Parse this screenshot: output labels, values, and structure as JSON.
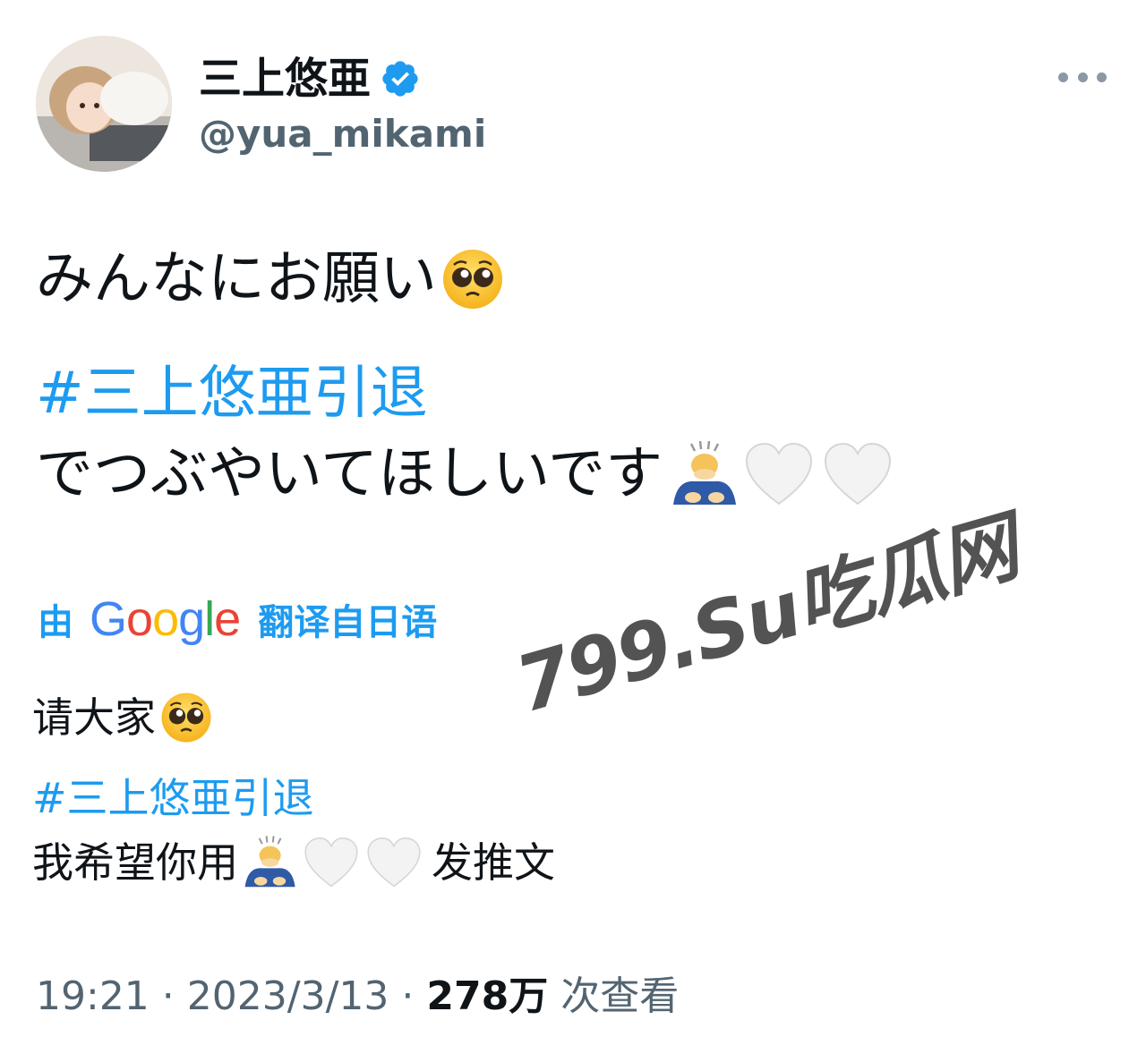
{
  "tweet": {
    "author": {
      "display_name": "三上悠亜",
      "handle": "@yua_mikami"
    },
    "original": {
      "line1": "みんなにお願い",
      "hashtag": "#三上悠亜引退",
      "line3": "でつぶやいてほしいです"
    },
    "translation_bar": {
      "prefix": "由",
      "provider_letters": [
        "G",
        "o",
        "o",
        "g",
        "l",
        "e"
      ],
      "suffix": "翻译自日语"
    },
    "translated": {
      "line1": "请大家",
      "hashtag": "#三上悠亜引退",
      "line3_before": "我希望你用",
      "line3_after": "发推文"
    },
    "meta": {
      "time": "19:21",
      "separator": " · ",
      "date": "2023/3/13",
      "views_count": "278万",
      "views_label": " 次查看"
    },
    "icons": [
      "avatar-image",
      "verified-badge-icon",
      "more-options-icon",
      "pleading-face-emoji",
      "bowing-person-emoji",
      "white-heart-emoji"
    ],
    "colors": {
      "link": "#1d9bf0",
      "secondary_text": "#536471",
      "verified": "#1d9bf0"
    }
  },
  "watermark": {
    "text": "799.Su吃瓜网"
  }
}
